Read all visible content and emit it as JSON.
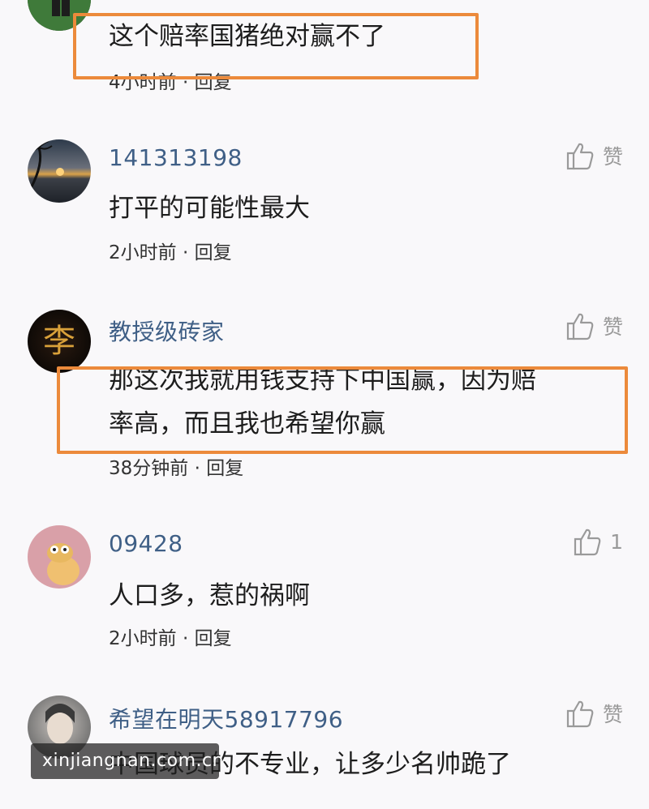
{
  "comments": [
    {
      "username": "",
      "text": "这个赔率国猪绝对赢不了",
      "time": "4小时前",
      "reply": "回复",
      "like": "赞"
    },
    {
      "username": "141313198",
      "text": "打平的可能性最大",
      "time": "2小时前",
      "reply": "回复",
      "like": "赞"
    },
    {
      "username": "教授级砖家",
      "text_line1": "那这次我就用钱支持下中国赢，因为赔",
      "text_line2": "率高，而且我也希望你赢",
      "time": "38分钟前",
      "reply": "回复",
      "like": "赞",
      "avatar_glyph": "李"
    },
    {
      "username": "09428",
      "text": "人口多，惹的祸啊",
      "time": "2小时前",
      "reply": "回复",
      "like": "1"
    },
    {
      "username": "希望在明天58917796",
      "text": "中国球员的不专业，让多少名帅跪了",
      "like": "赞"
    }
  ],
  "meta_separator": "·",
  "watermark": "xinjiangnan.com.cn",
  "colors": {
    "background": "#f9f8fa",
    "username": "#3f5f86",
    "highlight": "#ec8a3b",
    "like": "#9a9a9a"
  }
}
